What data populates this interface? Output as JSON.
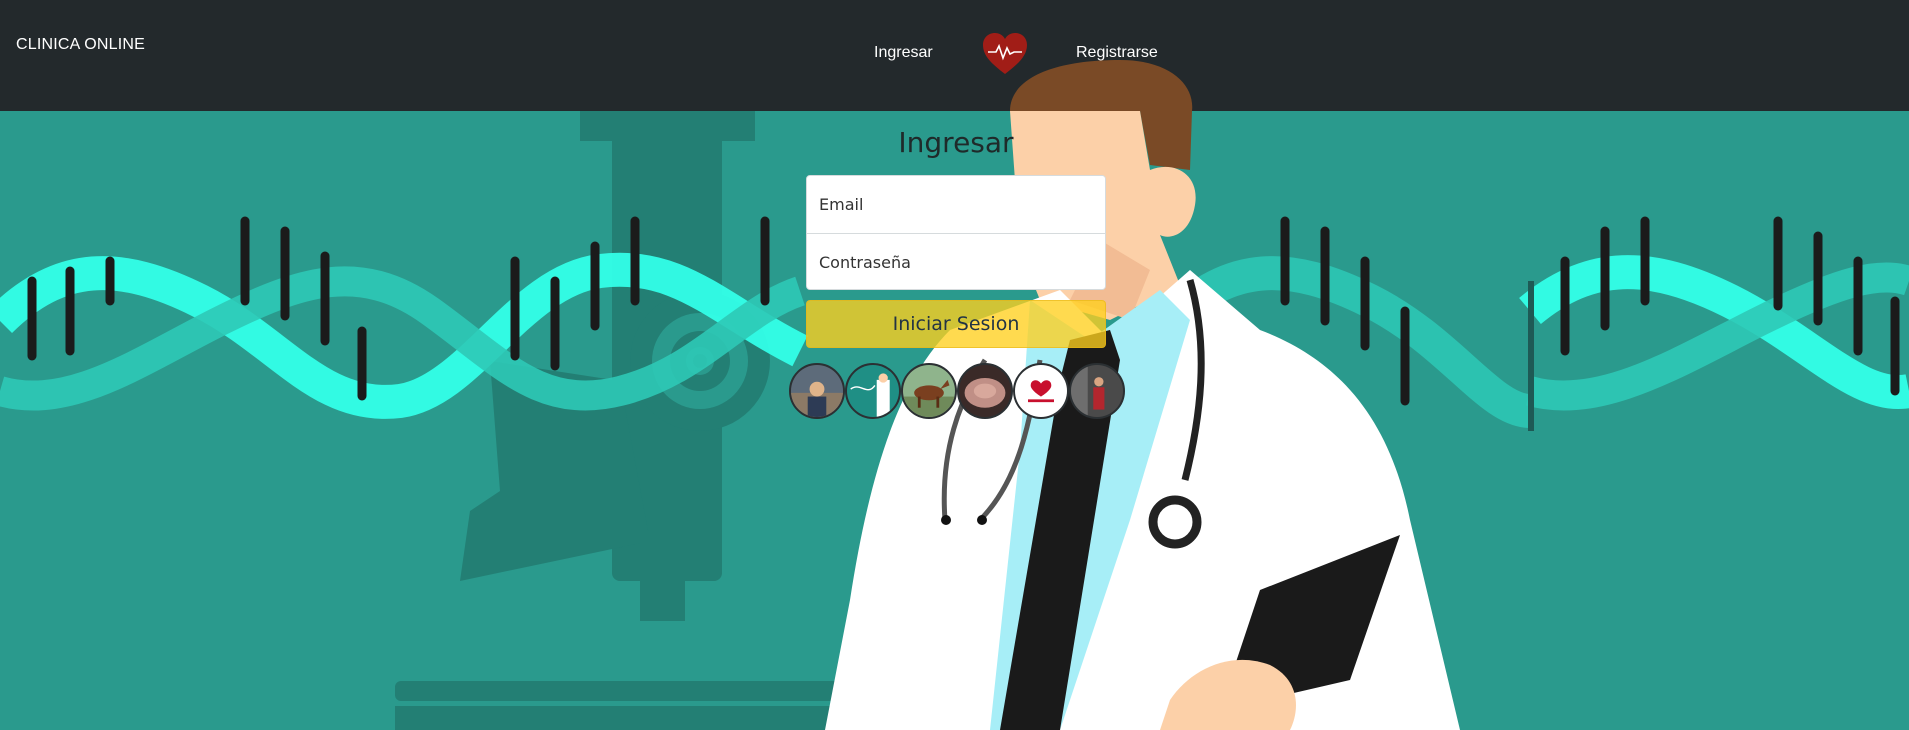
{
  "navbar": {
    "brand": "CLINICA ONLINE",
    "login_link": "Ingresar",
    "register_link": "Registrarse",
    "logo_icon": "heart-pulse-icon",
    "background_color": "#23292c"
  },
  "login": {
    "title": "Ingresar",
    "email_placeholder": "Email",
    "password_placeholder": "Contraseña",
    "submit_label": "Iniciar Sesion",
    "button_color": "#ffd01e"
  },
  "quick_login_avatars": [
    {
      "name": "avatar-user-1"
    },
    {
      "name": "avatar-user-2"
    },
    {
      "name": "avatar-user-3"
    },
    {
      "name": "avatar-user-4"
    },
    {
      "name": "avatar-user-5"
    },
    {
      "name": "avatar-user-6"
    }
  ],
  "theme": {
    "background": "#2a9a8d",
    "dna_color": "#33ffe8"
  }
}
